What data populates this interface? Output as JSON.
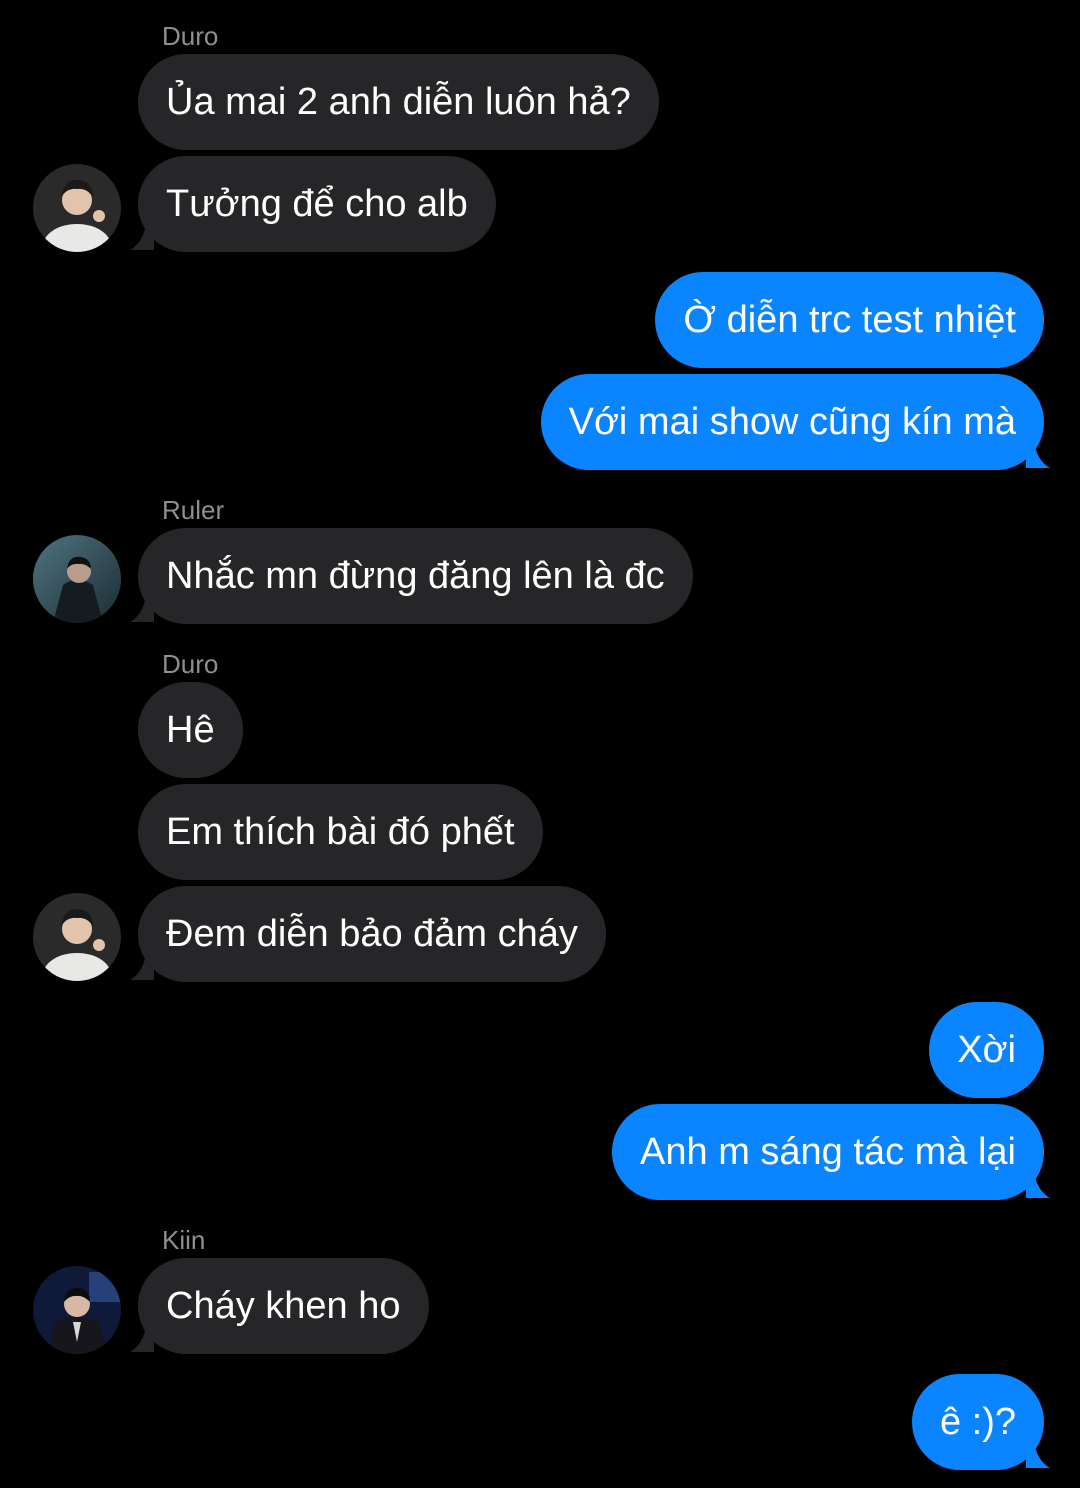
{
  "colors": {
    "background": "#000000",
    "incoming_bubble": "#262628",
    "outgoing_bubble": "#0a84ff",
    "sender_name": "#8e8e93",
    "text": "#ffffff"
  },
  "messages": [
    {
      "sender": "Duro",
      "text": "Ủa mai 2 anh diễn luôn hả?"
    },
    {
      "text": "Tưởng để cho alb",
      "avatar": "duro-avatar"
    },
    {
      "text": "Ờ diễn trc test nhiệt"
    },
    {
      "text": "Với mai show cũng kín mà"
    },
    {
      "sender": "Ruler",
      "text": "Nhắc mn đừng đăng lên là đc",
      "avatar": "ruler-avatar"
    },
    {
      "sender": "Duro",
      "text": "Hê"
    },
    {
      "text": "Em thích bài đó phết"
    },
    {
      "text": "Đem diễn bảo đảm cháy",
      "avatar": "duro-avatar"
    },
    {
      "text": "Xời"
    },
    {
      "text": "Anh m sáng tác mà lại"
    },
    {
      "sender": "Kiin",
      "text": "Cháy khen ho",
      "avatar": "kiin-avatar"
    },
    {
      "text": "ê :)?"
    }
  ]
}
